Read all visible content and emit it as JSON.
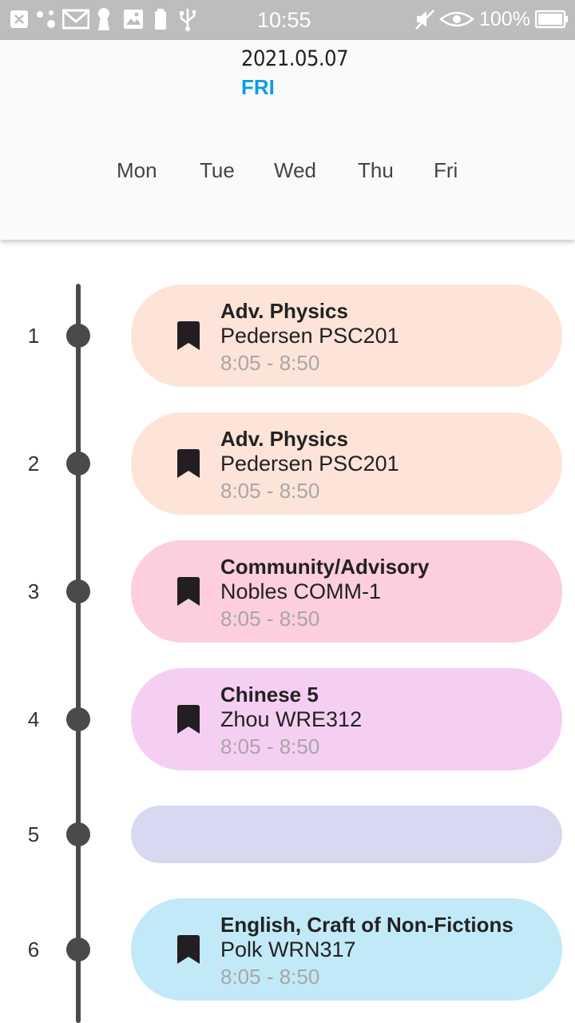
{
  "status_bar": {
    "time": "10:55",
    "battery": "100%"
  },
  "header": {
    "date": "2021.05.07",
    "day": "FRI",
    "weekdays": [
      "Mon",
      "Tue",
      "Wed",
      "Thu",
      "Fri"
    ]
  },
  "schedule": [
    {
      "period": "1",
      "course": "Adv. Physics",
      "teacher_room": "Pedersen PSC201",
      "time": "8:05 - 8:50",
      "color": "#fde3d8"
    },
    {
      "period": "2",
      "course": "Adv. Physics",
      "teacher_room": "Pedersen PSC201",
      "time": "8:05 - 8:50",
      "color": "#fde3d8"
    },
    {
      "period": "3",
      "course": "Community/Advisory",
      "teacher_room": "Nobles COMM-1",
      "time": "8:05 - 8:50",
      "color": "#fdcedd"
    },
    {
      "period": "4",
      "course": "Chinese 5",
      "teacher_room": "Zhou WRE312",
      "time": "8:05 - 8:50",
      "color": "#f5cff2"
    },
    {
      "period": "5",
      "color": "#d8d8f0"
    },
    {
      "period": "6",
      "course": "English, Craft of Non-Fictions",
      "teacher_room": "Polk WRN317",
      "time": "8:05 - 8:50",
      "color": "#c2e9f8"
    }
  ]
}
